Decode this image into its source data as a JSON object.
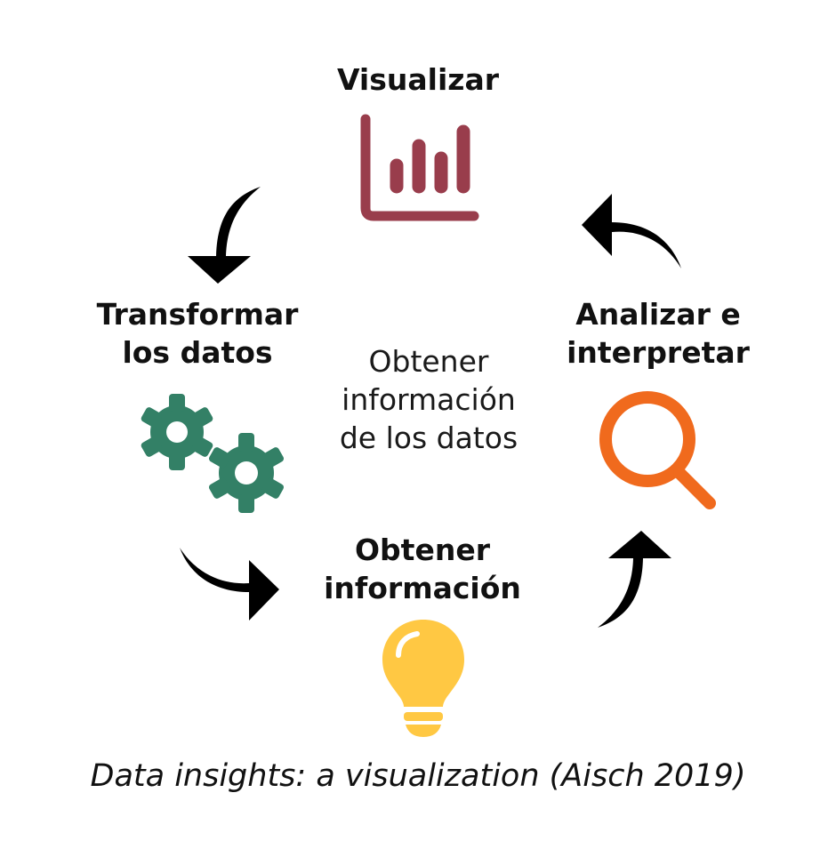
{
  "stages": {
    "visualize": {
      "label": "Visualizar"
    },
    "transform": {
      "line1": "Transformar",
      "line2": "los datos"
    },
    "analyze": {
      "line1": "Analizar e",
      "line2": "interpretar"
    },
    "obtain": {
      "line1": "Obtener",
      "line2": "información"
    }
  },
  "center": {
    "line1": "Obtener",
    "line2": "información",
    "line3": "de los datos"
  },
  "caption": "Data insights: a visualization (Aisch 2019)",
  "icons": {
    "visualize": "bar-chart-icon",
    "transform": "gears-icon",
    "analyze": "magnifier-icon",
    "obtain": "lightbulb-icon"
  },
  "colors": {
    "chart": "#993d4c",
    "gears": "#338066",
    "magnifier": "#f06a1d",
    "bulb": "#ffc843",
    "arrows": "#000000"
  }
}
